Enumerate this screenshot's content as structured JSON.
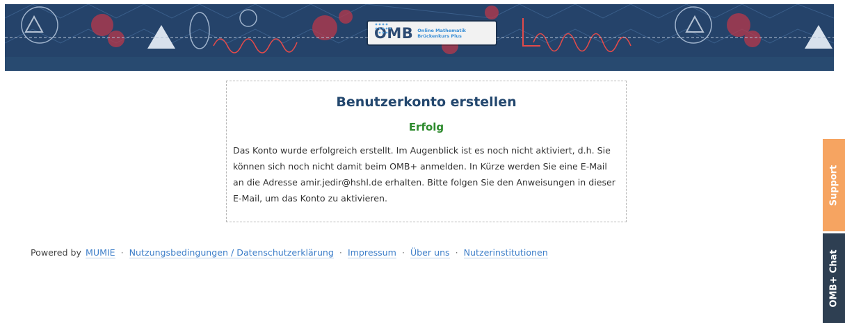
{
  "header": {
    "logo_text": "OMB",
    "logo_subtitle_line1": "Online Mathematik",
    "logo_subtitle_line2": "Brückenkurs Plus"
  },
  "card": {
    "title": "Benutzerkonto erstellen",
    "status": "Erfolg",
    "message": "Das Konto wurde erfolgreich erstellt. Im Augenblick ist es noch nicht aktiviert, d.h. Sie können sich noch nicht damit beim OMB+ anmelden. In Kürze werden Sie eine E-Mail an die Adresse amir.jedir@hshl.de erhalten. Bitte folgen Sie den Anweisungen in dieser E-Mail, um das Konto zu aktivieren."
  },
  "footer": {
    "powered_by": "Powered by",
    "links": [
      "MUMIE",
      "Nutzungsbedingungen / Datenschutzerklärung",
      "Impressum",
      "Über uns",
      "Nutzerinstitutionen"
    ],
    "separator": "·"
  },
  "side_tabs": {
    "support": "Support",
    "chat": "OMB+ Chat"
  },
  "colors": {
    "banner": "#25436a",
    "title": "#23476e",
    "success": "#2e8b2e",
    "link": "#3d7ec9",
    "support_tab": "#f6a461",
    "chat_tab": "#2e3f52"
  }
}
